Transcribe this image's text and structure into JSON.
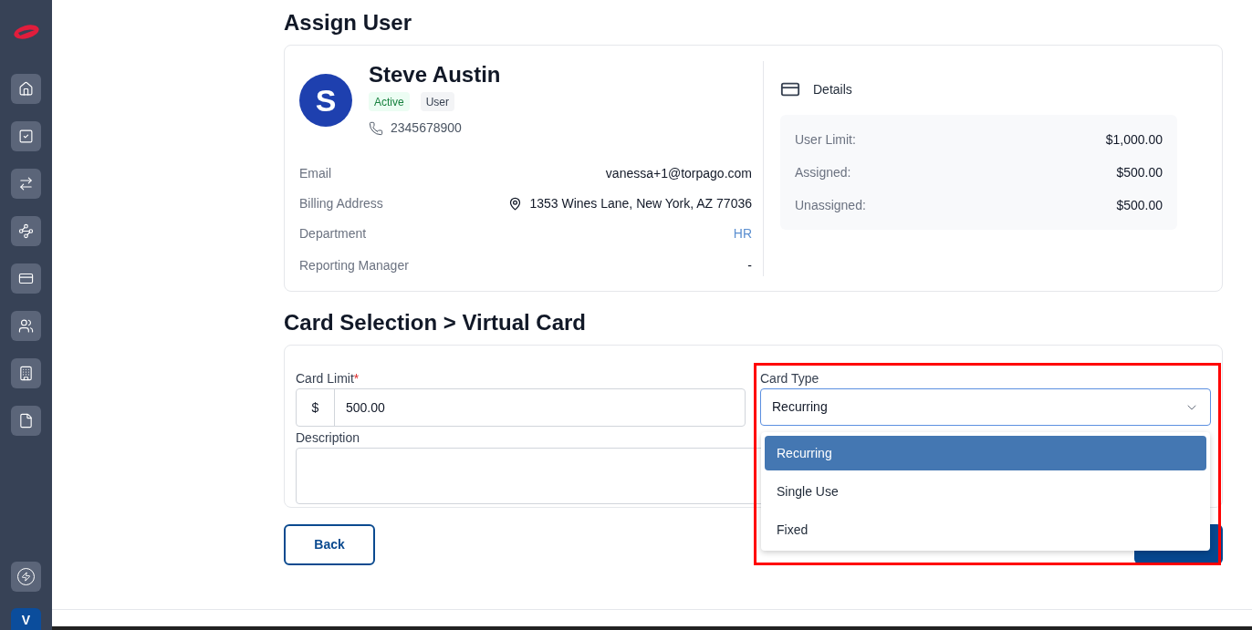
{
  "sidebar": {
    "nav_items": [
      {
        "kind": "home",
        "selected": false
      },
      {
        "kind": "tasks",
        "selected": false
      },
      {
        "kind": "transfers",
        "selected": false
      },
      {
        "kind": "routing",
        "selected": false
      },
      {
        "kind": "cards",
        "selected": false
      },
      {
        "kind": "users",
        "selected": false
      },
      {
        "kind": "company",
        "selected": false
      },
      {
        "kind": "documents",
        "selected": false
      }
    ],
    "bottom_items": [
      {
        "kind": "activity"
      }
    ],
    "account": {
      "initial": "V"
    }
  },
  "assign_user": {
    "title": "Assign User",
    "user": {
      "initial": "S",
      "name": "Steve Austin",
      "badges": [
        {
          "label": "Active",
          "kind": "status"
        },
        {
          "label": "User",
          "kind": "role"
        }
      ],
      "phone": "2345678900"
    },
    "fields": [
      {
        "label": "Email",
        "value": "vanessa+1@torpago.com",
        "kind": "text"
      },
      {
        "label": "Billing Address",
        "value": "1353 Wines Lane, New York, AZ 77036",
        "kind": "address"
      },
      {
        "label": "Department",
        "value": "HR",
        "kind": "link"
      },
      {
        "label": "Reporting Manager",
        "value": "-",
        "kind": "text"
      }
    ],
    "details": {
      "title": "Details",
      "rows": [
        {
          "label": "User Limit:",
          "value": "$1,000.00"
        },
        {
          "label": "Assigned:",
          "value": "$500.00"
        },
        {
          "label": "Unassigned:",
          "value": "$500.00"
        }
      ]
    }
  },
  "card_selection": {
    "title": "Card Selection > Virtual Card",
    "card_limit": {
      "label": "Card Limit",
      "required_mark": "*",
      "prefix": "$",
      "value": "500.00"
    },
    "description": {
      "label": "Description"
    },
    "card_type": {
      "label": "Card Type",
      "value": "Recurring",
      "expanded": true,
      "highlighted": true,
      "options": [
        {
          "label": "Recurring",
          "selected": true
        },
        {
          "label": "Single Use",
          "selected": false
        },
        {
          "label": "Fixed",
          "selected": false
        }
      ]
    }
  },
  "buttons": {
    "back": "Back"
  }
}
